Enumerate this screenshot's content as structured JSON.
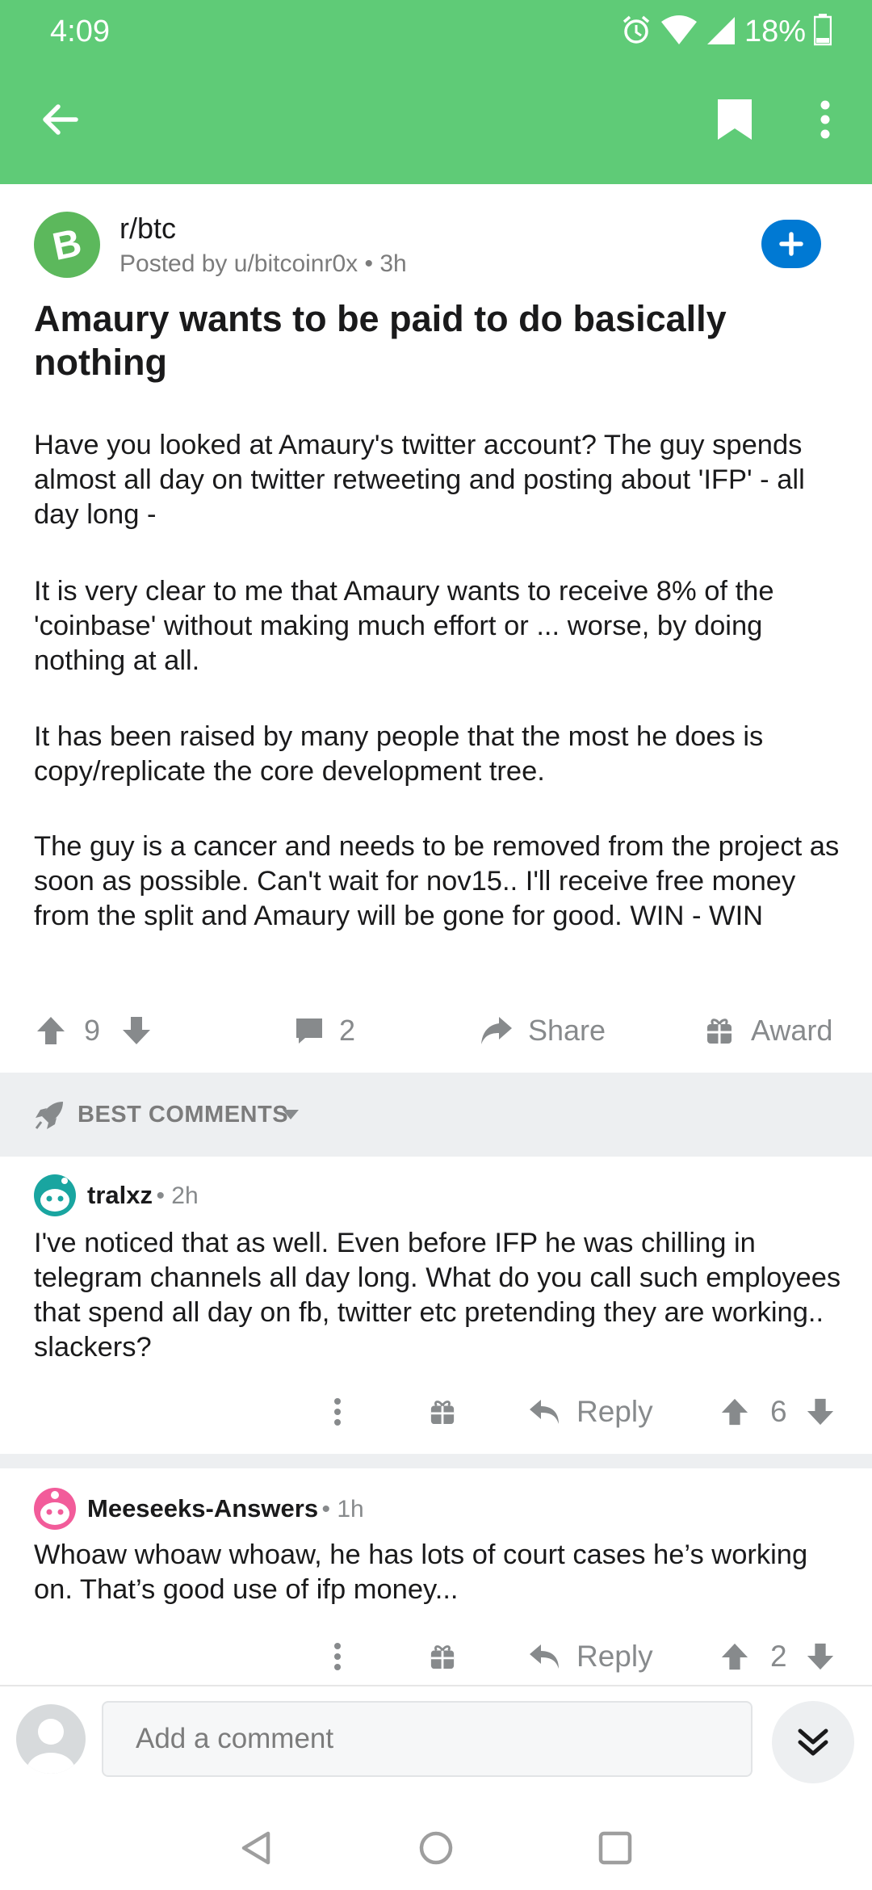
{
  "status": {
    "time": "4:09",
    "battery": "18%"
  },
  "post": {
    "subreddit": "r/btc",
    "meta": "Posted by u/bitcoinr0x • 3h",
    "title": "Amaury wants to be paid to do basically nothing",
    "paragraphs": [
      "Have you looked at Amaury's twitter account? The guy spends almost all day on twitter retweeting and posting about 'IFP' - all day long -",
      "It is very clear to me that Amaury wants to receive 8% of the 'coinbase' without making much effort or ... worse, by doing nothing at all.",
      "It has been raised by many people that the most he does is copy/replicate the core development tree.",
      "The guy is a cancer and needs to be removed from the project as soon as possible. Can't wait for nov15.. I'll receive free money from the split and Amaury will be gone for good. WIN - WIN"
    ],
    "votes": "9",
    "comments": "2",
    "share_label": "Share",
    "award_label": "Award"
  },
  "sort": {
    "label": "BEST COMMENTS"
  },
  "comments": [
    {
      "author": "tralxz",
      "time": "• 2h",
      "text": "I've noticed that as well. Even before IFP  he was chilling in telegram channels  all day long. What do you call such employees that spend all day on fb, twitter etc pretending they are working.. slackers?",
      "reply_label": "Reply",
      "votes": "6"
    },
    {
      "author": "Meeseeks-Answers",
      "time": "• 1h",
      "text": "Whoaw whoaw whoaw, he has lots of court cases he’s working on. That’s good use of ifp money...",
      "reply_label": "Reply",
      "votes": "2"
    }
  ],
  "composer": {
    "placeholder": "Add a comment"
  },
  "colors": {
    "header": "#5fcb77",
    "accent": "#0079d3",
    "muted": "#878a8c"
  }
}
